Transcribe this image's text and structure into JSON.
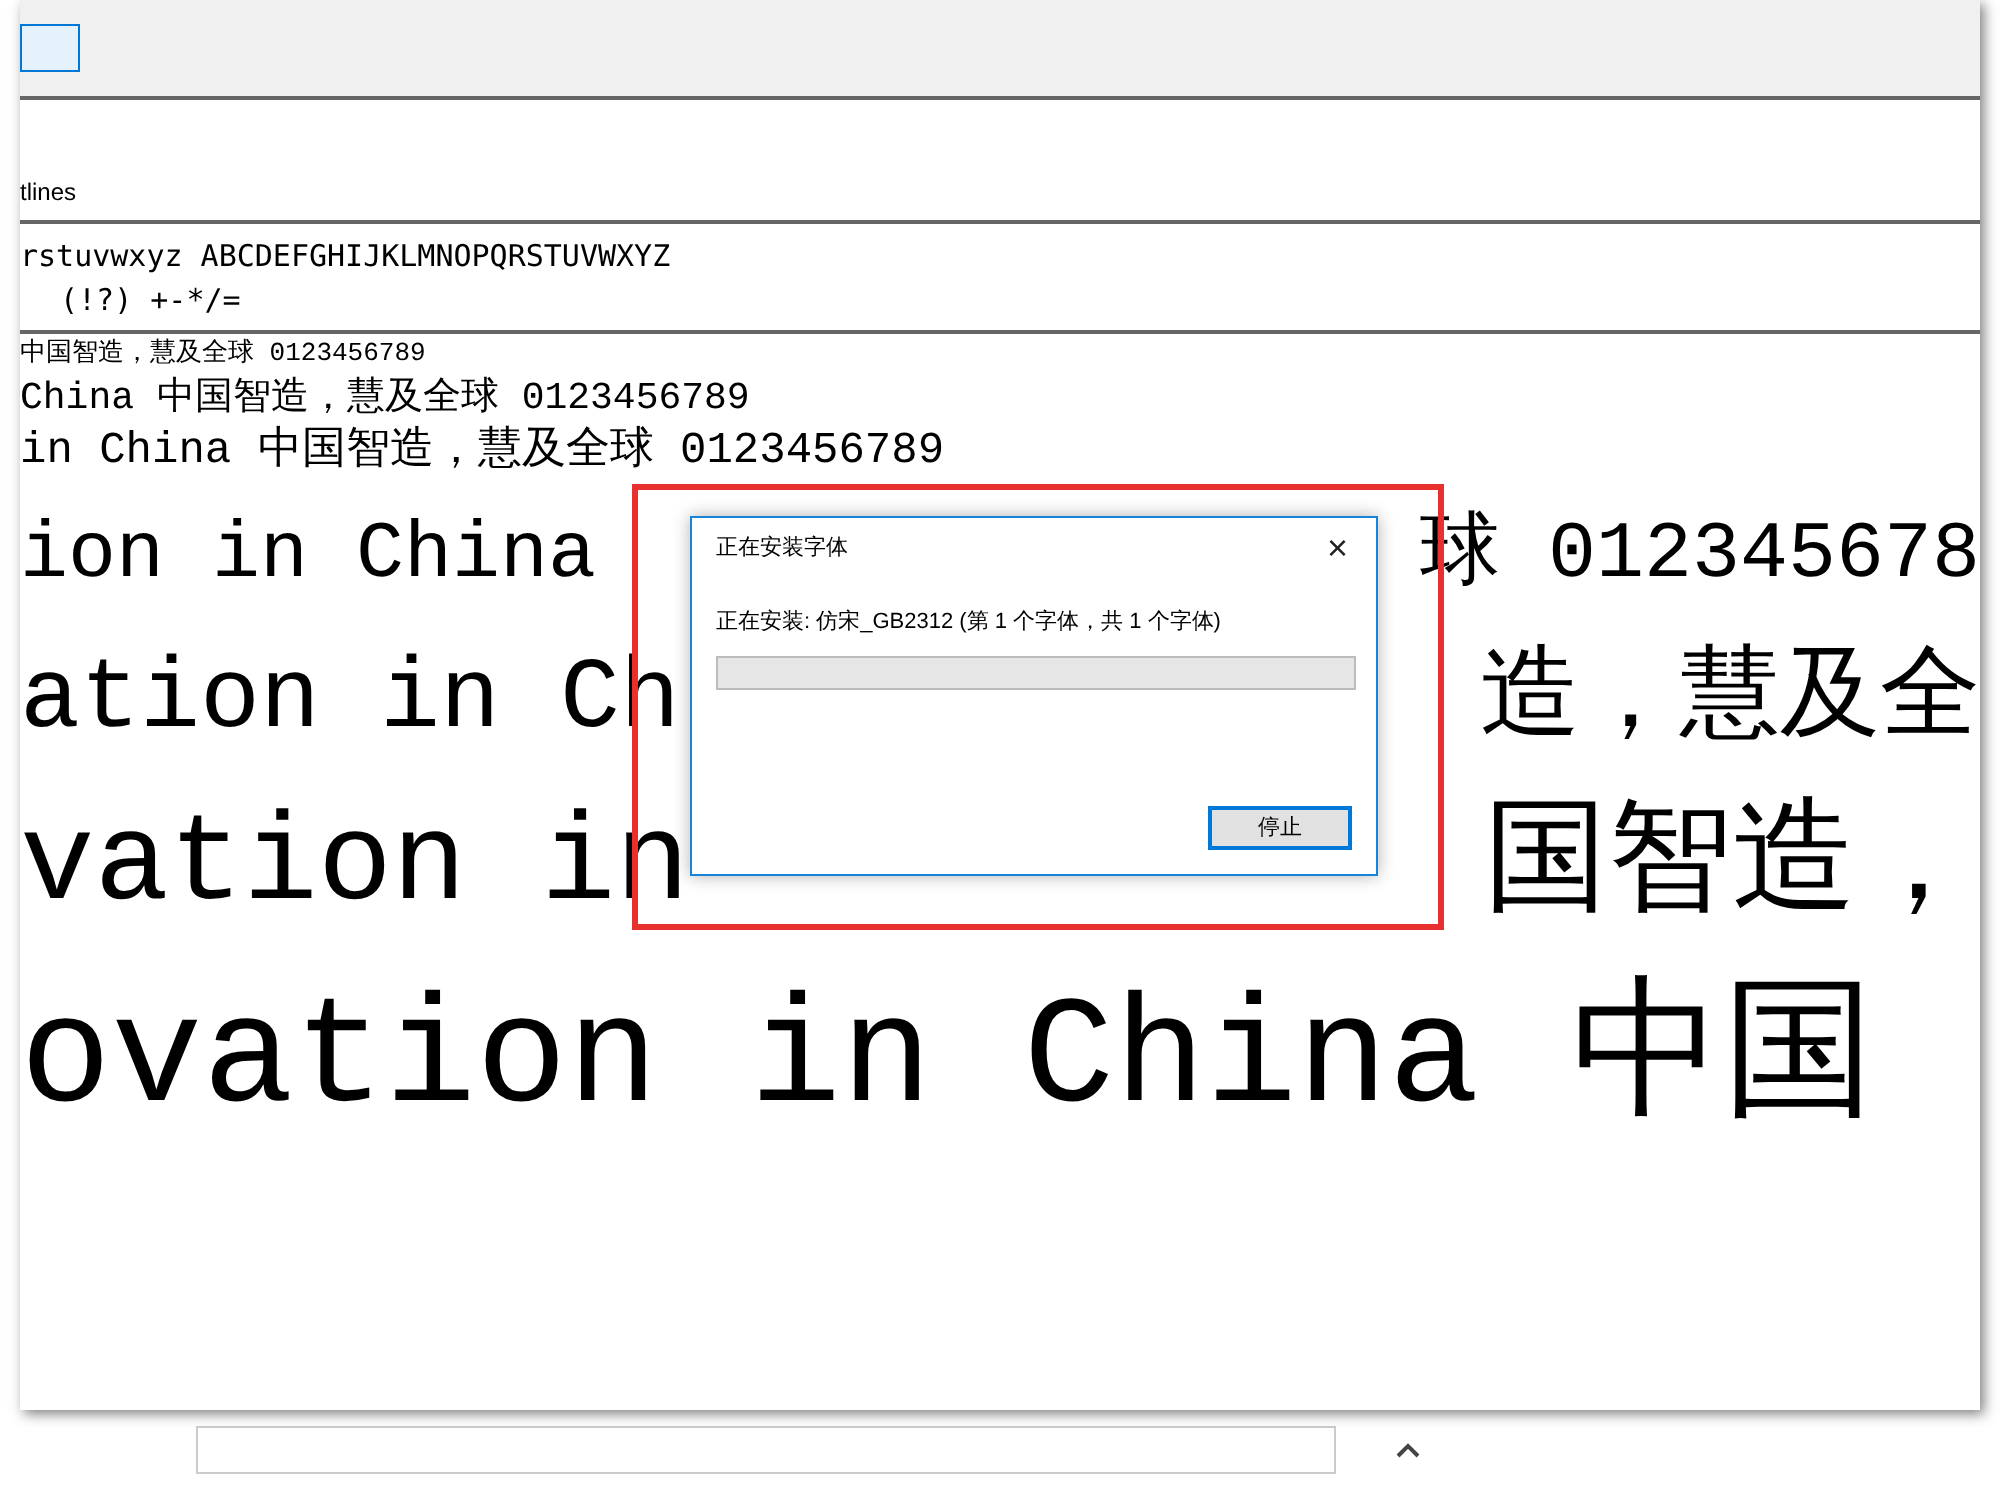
{
  "toolbar": {
    "tab_label": "tlines"
  },
  "samples": [
    "rstuvwxyz ABCDEFGHIJKLMNOPQRSTUVWXYZ",
    "(!?) +-*/="
  ],
  "preview_rows": [
    {
      "left": "中国智造，慧及全球 0123456789"
    },
    {
      "left": "China 中国智造，慧及全球 0123456789"
    },
    {
      "left": "in China 中国智造，慧及全球 0123456789"
    },
    {
      "left": "ion in China",
      "right": "球 012345678"
    },
    {
      "left": "ation in Ch",
      "right": "造，慧及全"
    },
    {
      "left": "vation in",
      "right": "国智造，"
    },
    {
      "left": "ovation in China 中国"
    }
  ],
  "dialog": {
    "title": "正在安装字体",
    "close": "×",
    "message": "正在安装: 仿宋_GB2312 (第 1 个字体，共 1 个字体)",
    "progress": {
      "level": 0
    },
    "button": "停止"
  }
}
